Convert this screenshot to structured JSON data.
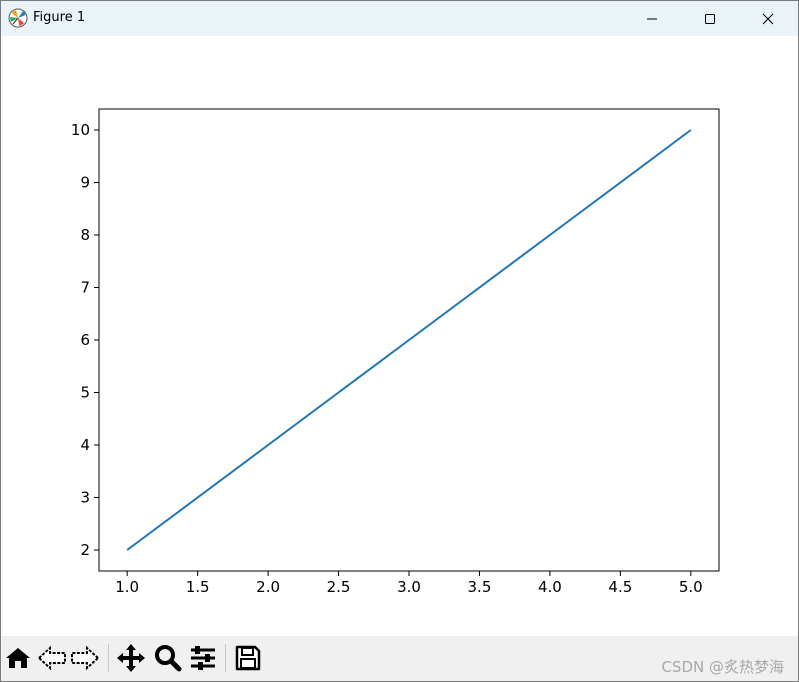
{
  "window": {
    "title": "Figure 1"
  },
  "toolbar": {
    "buttons": [
      {
        "name": "home",
        "icon": "home-icon"
      },
      {
        "name": "back",
        "icon": "arrow-left-icon"
      },
      {
        "name": "forward",
        "icon": "arrow-right-icon"
      },
      {
        "name": "pan",
        "icon": "move-icon"
      },
      {
        "name": "zoom",
        "icon": "magnifier-icon"
      },
      {
        "name": "configure",
        "icon": "sliders-icon"
      },
      {
        "name": "save",
        "icon": "floppy-disk-icon"
      }
    ],
    "watermark": "CSDN @炙热梦海"
  },
  "chart_data": {
    "type": "line",
    "title": "",
    "xlabel": "",
    "ylabel": "",
    "xlim": [
      0.8,
      5.2
    ],
    "ylim": [
      1.6,
      10.4
    ],
    "xticks": [
      "1.0",
      "1.5",
      "2.0",
      "2.5",
      "3.0",
      "3.5",
      "4.0",
      "4.5",
      "5.0"
    ],
    "yticks": [
      "2",
      "3",
      "4",
      "5",
      "6",
      "7",
      "8",
      "9",
      "10"
    ],
    "series": [
      {
        "x": [
          1,
          2,
          3,
          4,
          5
        ],
        "y": [
          2,
          4,
          6,
          8,
          10
        ],
        "color": "#1f77b4"
      }
    ],
    "grid": false,
    "legend": false
  }
}
